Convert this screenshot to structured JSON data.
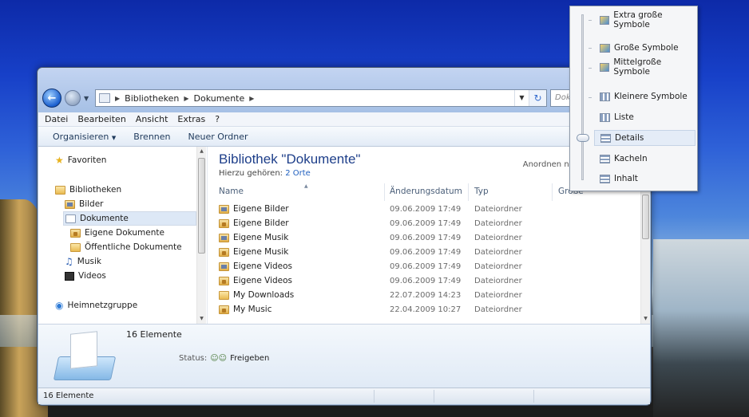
{
  "address": {
    "crumbs": [
      "Bibliotheken",
      "Dokumente"
    ],
    "search_placeholder": "Dokumente durchsuchen"
  },
  "menu": [
    "Datei",
    "Bearbeiten",
    "Ansicht",
    "Extras",
    "?"
  ],
  "toolbar": {
    "organize": "Organisieren",
    "burn": "Brennen",
    "new_folder": "Neuer Ordner"
  },
  "nav": {
    "favorites": "Favoriten",
    "libraries": "Bibliotheken",
    "pictures": "Bilder",
    "documents": "Dokumente",
    "my_documents": "Eigene Dokumente",
    "public_documents": "Öffentliche Dokumente",
    "music": "Musik",
    "videos": "Videos",
    "homegroup": "Heimnetzgruppe"
  },
  "library": {
    "title": "Bibliothek \"Dokumente\"",
    "includes_label": "Hierzu gehören:",
    "includes_link": "2 Orte",
    "arrange": "Anordnen nach:"
  },
  "columns": {
    "name": "Name",
    "date": "Änderungsdatum",
    "type": "Typ",
    "size": "Größe"
  },
  "files": [
    {
      "name": "Eigene Bilder",
      "date": "09.06.2009 17:49",
      "type": "Dateiordner",
      "icon": "pub"
    },
    {
      "name": "Eigene Bilder",
      "date": "09.06.2009 17:49",
      "type": "Dateiordner",
      "icon": "priv"
    },
    {
      "name": "Eigene Musik",
      "date": "09.06.2009 17:49",
      "type": "Dateiordner",
      "icon": "pub"
    },
    {
      "name": "Eigene Musik",
      "date": "09.06.2009 17:49",
      "type": "Dateiordner",
      "icon": "priv"
    },
    {
      "name": "Eigene Videos",
      "date": "09.06.2009 17:49",
      "type": "Dateiordner",
      "icon": "pub"
    },
    {
      "name": "Eigene Videos",
      "date": "09.06.2009 17:49",
      "type": "Dateiordner",
      "icon": "priv"
    },
    {
      "name": "My Downloads",
      "date": "22.07.2009 14:23",
      "type": "Dateiordner",
      "icon": "plain"
    },
    {
      "name": "My Music",
      "date": "22.04.2009 10:27",
      "type": "Dateiordner",
      "icon": "priv"
    }
  ],
  "details": {
    "count": "16 Elemente",
    "status_label": "Status:",
    "status_value": "Freigeben"
  },
  "statusbar": "16 Elemente",
  "view_menu": {
    "items": [
      "Extra große Symbole",
      "Große Symbole",
      "Mittelgroße Symbole",
      "Kleinere Symbole",
      "Liste",
      "Details",
      "Kacheln",
      "Inhalt"
    ],
    "selected": "Details"
  }
}
